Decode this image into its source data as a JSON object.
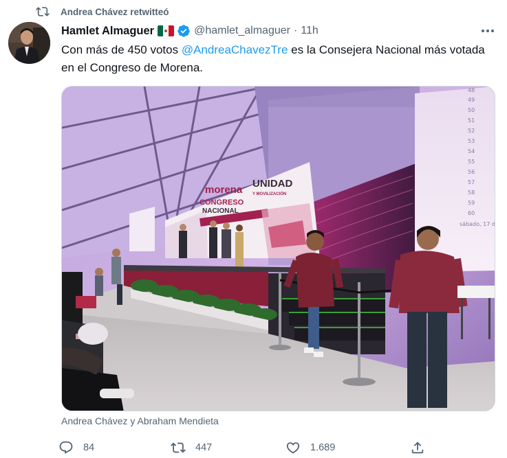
{
  "retweet": {
    "text": "Andrea Chávez retwitteó",
    "icon": "retweet-icon"
  },
  "author": {
    "display_name": "Hamlet Almaguer",
    "flag": "mexico-flag",
    "verified_icon": "verified-badge-icon",
    "handle": "@hamlet_almaguer",
    "separator": "·",
    "time": "11h"
  },
  "tweet": {
    "text_before": "Con más de 450 votos ",
    "mention": "@AndreaChavezTre",
    "text_after": " es la Consejera Nacional más votada en el Congreso de Morena."
  },
  "media": {
    "description_icon": "photo",
    "stage_banner_line1": "morena",
    "stage_banner_line2": "CONGRESO",
    "stage_banner_line3": "NACIONAL",
    "stage_banner_right1": "UNIDAD",
    "stage_banner_right2": "Y MOVILIZACIÓN",
    "screen_numbers": [
      "48",
      "49",
      "50",
      "51",
      "52",
      "53",
      "54",
      "55",
      "56",
      "57",
      "58",
      "59",
      "60"
    ],
    "screen_date": "sábado, 17 d"
  },
  "caption": "Andrea Chávez y Abraham Mendieta",
  "actions": {
    "replies": "84",
    "retweets": "447",
    "likes": "1.689"
  },
  "colors": {
    "text_primary": "#0f1419",
    "text_secondary": "#536471",
    "link": "#1d9bf0",
    "verified": "#1d9bf0"
  }
}
